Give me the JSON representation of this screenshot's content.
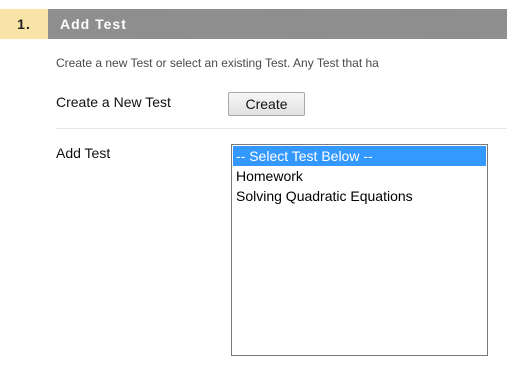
{
  "step": {
    "number": "1.",
    "title": "Add Test"
  },
  "instructions": "Create a new Test or select an existing Test. Any Test that ha",
  "create_row": {
    "label": "Create a New Test",
    "button_label": "Create"
  },
  "add_row": {
    "label": "Add Test",
    "options": [
      {
        "label": "-- Select Test Below --",
        "selected": true
      },
      {
        "label": "Homework",
        "selected": false
      },
      {
        "label": "Solving Quadratic Equations",
        "selected": false
      }
    ]
  },
  "colors": {
    "step_number_bg": "#f9e4a8",
    "title_bar_bg": "#8c8c8c",
    "selection_bg": "#3399ff"
  }
}
